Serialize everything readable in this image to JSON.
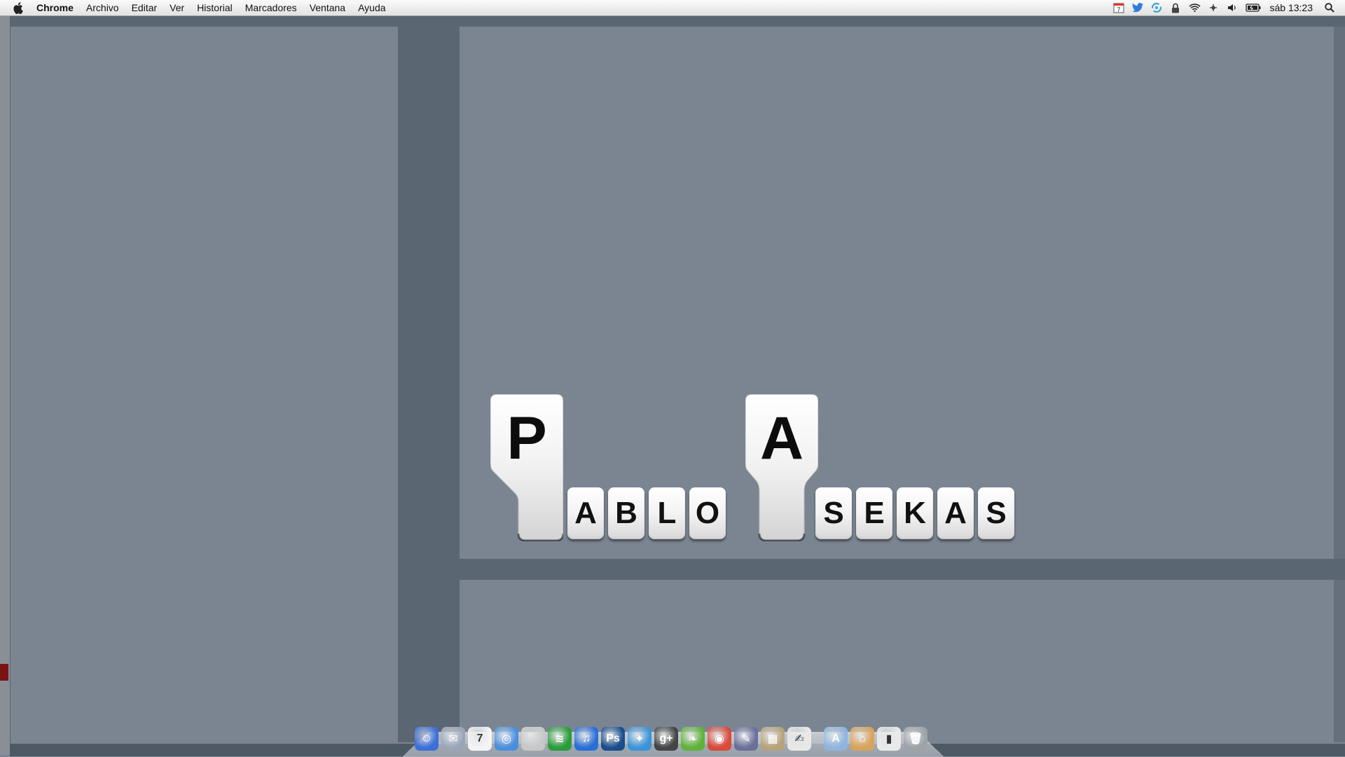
{
  "menubar": {
    "app_name": "Chrome",
    "menus": [
      "Archivo",
      "Editar",
      "Ver",
      "Historial",
      "Marcadores",
      "Ventana",
      "Ayuda"
    ],
    "status_icons": [
      "calendar-icon",
      "twitter-icon",
      "sync-icon",
      "lock-icon",
      "wifi-icon",
      "bluetooth-icon",
      "volume-icon",
      "battery-icon"
    ],
    "calendar_day": "7",
    "clock": "sáb 13:23"
  },
  "logo": {
    "first_initial": "P",
    "first_rest": [
      "A",
      "B",
      "L",
      "O"
    ],
    "last_initial": "A",
    "last_rest": [
      "S",
      "E",
      "K",
      "A",
      "S"
    ]
  },
  "dock": {
    "apps": [
      {
        "name": "finder-icon",
        "glyph": "☺",
        "color": "#3d6fd8"
      },
      {
        "name": "mail-icon",
        "glyph": "✉",
        "color": "#9aa6b8"
      },
      {
        "name": "calendar-icon",
        "glyph": "7",
        "color": "#f4f4f4"
      },
      {
        "name": "safari-icon",
        "glyph": "◎",
        "color": "#4a8fdc"
      },
      {
        "name": "apple-icon",
        "glyph": "",
        "color": "#c8c8c8"
      },
      {
        "name": "spotify-icon",
        "glyph": "≋",
        "color": "#2a9d3a"
      },
      {
        "name": "itunes-icon",
        "glyph": "♫",
        "color": "#2a6fd6"
      },
      {
        "name": "photoshop-icon",
        "glyph": "Ps",
        "color": "#1b4e8c"
      },
      {
        "name": "twitter-icon",
        "glyph": "✦",
        "color": "#3b94d9"
      },
      {
        "name": "google-plus-icon",
        "glyph": "g+",
        "color": "#444"
      },
      {
        "name": "leaf-icon",
        "glyph": "❧",
        "color": "#5fb33a"
      },
      {
        "name": "chrome-icon",
        "glyph": "◉",
        "color": "#d94a3a"
      },
      {
        "name": "quill-icon",
        "glyph": "✎",
        "color": "#6b6f9a"
      },
      {
        "name": "preview-icon",
        "glyph": "▦",
        "color": "#b7a37a"
      },
      {
        "name": "textedit-icon",
        "glyph": "✍",
        "color": "#e8e8e8"
      },
      {
        "name": "applications-folder-icon",
        "glyph": "A",
        "color": "#8eb5de"
      },
      {
        "name": "home-icon",
        "glyph": "⌂",
        "color": "#d9a35a"
      },
      {
        "name": "domino-icon",
        "glyph": "▮",
        "color": "#e9e9e9"
      },
      {
        "name": "trash-icon",
        "glyph": "🗑",
        "color": "#9ea3a8"
      }
    ]
  }
}
